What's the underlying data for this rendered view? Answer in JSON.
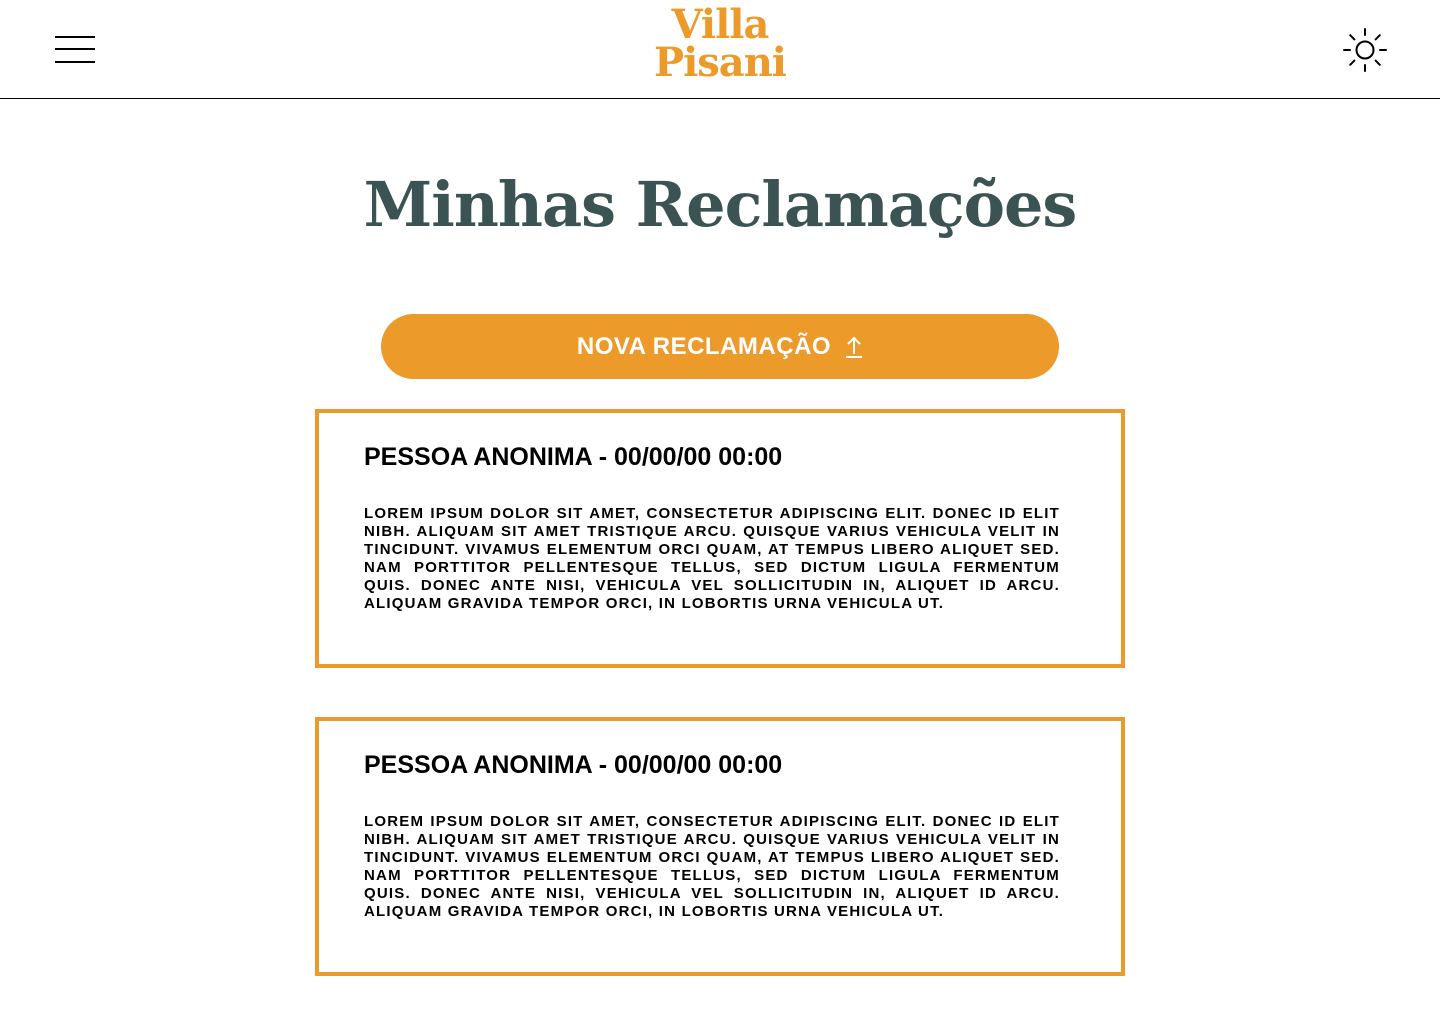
{
  "header": {
    "menu_icon": "hamburger-menu-icon",
    "logo": {
      "line1": "Villa",
      "line2": "Pisani"
    },
    "theme_icon": "sun-icon"
  },
  "main": {
    "title": "Minhas Reclamações",
    "new_button_label": "NOVA RECLAMAÇÃO",
    "new_button_icon": "arrow-up-icon",
    "complaints": [
      {
        "header": "PESSOA ANONIMA - 00/00/00 00:00",
        "text": "LOREM IPSUM DOLOR SIT AMET, CONSECTETUR ADIPISCING ELIT. DONEC ID ELIT NIBH. ALIQUAM SIT AMET TRISTIQUE ARCU. QUISQUE VARIUS VEHICULA VELIT IN TINCIDUNT. VIVAMUS ELEMENTUM ORCI QUAM, AT TEMPUS LIBERO ALIQUET SED. NAM PORTTITOR PELLENTESQUE TELLUS, SED DICTUM LIGULA FERMENTUM QUIS. DONEC ANTE NISI, VEHICULA VEL SOLLICITUDIN IN, ALIQUET ID ARCU. ALIQUAM GRAVIDA TEMPOR ORCI, IN LOBORTIS URNA VEHICULA UT."
      },
      {
        "header": "PESSOA ANONIMA - 00/00/00 00:00",
        "text": "LOREM IPSUM DOLOR SIT AMET, CONSECTETUR ADIPISCING ELIT. DONEC ID ELIT NIBH. ALIQUAM SIT AMET TRISTIQUE ARCU. QUISQUE VARIUS VEHICULA VELIT IN TINCIDUNT. VIVAMUS ELEMENTUM ORCI QUAM, AT TEMPUS LIBERO ALIQUET SED. NAM PORTTITOR PELLENTESQUE TELLUS, SED DICTUM LIGULA FERMENTUM QUIS. DONEC ANTE NISI, VEHICULA VEL SOLLICITUDIN IN, ALIQUET ID ARCU. ALIQUAM GRAVIDA TEMPOR ORCI, IN LOBORTIS URNA VEHICULA UT."
      }
    ]
  },
  "colors": {
    "accent": "#ec9a2a",
    "title": "#3b5352",
    "text": "#000000",
    "background": "#ffffff"
  }
}
